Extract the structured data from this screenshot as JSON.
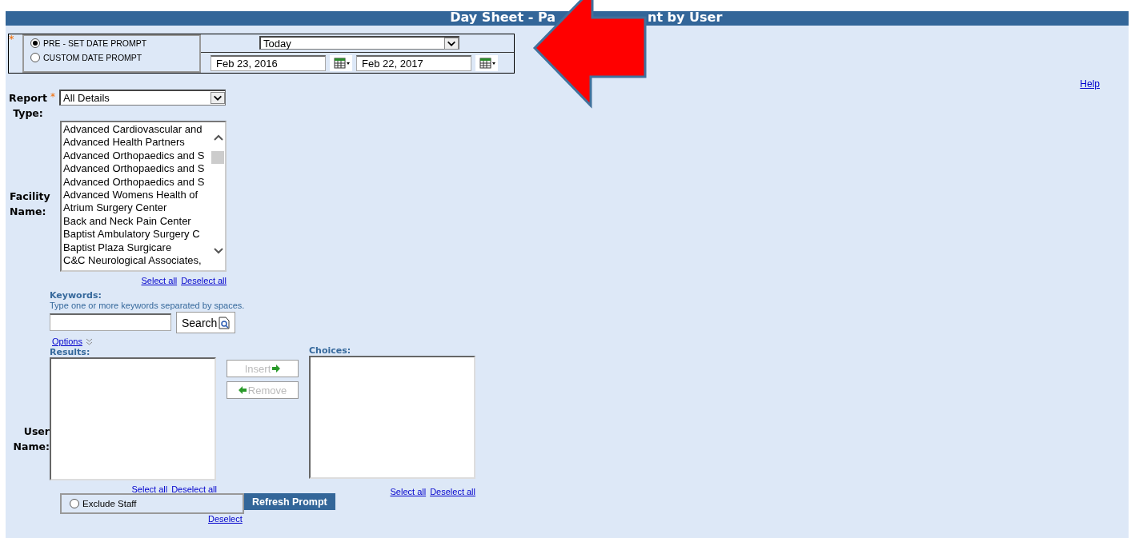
{
  "title_parts": [
    "Day Sheet - Pa",
    "nt by User"
  ],
  "date_prompt": {
    "required_mark": "*",
    "options": [
      {
        "label": "PRE - SET DATE PROMPT",
        "selected": true
      },
      {
        "label": "CUSTOM DATE PROMPT",
        "selected": false
      }
    ],
    "preset": "Today",
    "start_date": "Feb 23, 2016",
    "end_date": "Feb 22, 2017"
  },
  "help_link": "Help",
  "report_type": {
    "label": "Report Type:",
    "required_mark": "*",
    "value": "All Details"
  },
  "facility": {
    "label": "Facility Name:",
    "items": [
      "Advanced Cardiovascular and",
      "Advanced Health Partners",
      "Advanced Orthopaedics and S",
      "Advanced Orthopaedics and S",
      "Advanced Orthopaedics and S",
      "Advanced Womens Health of",
      "Atrium Surgery Center",
      "Back and Neck Pain Center",
      "Baptist Ambulatory Surgery C",
      "Baptist Plaza Surgicare",
      "C&C Neurological Associates,"
    ],
    "select_all": "Select all",
    "deselect_all": "Deselect all"
  },
  "keywords": {
    "label": "Keywords:",
    "hint": "Type one or more keywords separated by spaces.",
    "search_button": "Search",
    "options_link": "Options"
  },
  "user": {
    "label": "User Name:",
    "results_label": "Results:",
    "choices_label": "Choices:",
    "insert_button": {
      "label": "Insert",
      "disabled": true
    },
    "remove_button": {
      "label": "Remove",
      "disabled": true
    },
    "results_select_all": "Select all",
    "results_deselect_all": "Deselect all",
    "choices_select_all": "Select all",
    "choices_deselect_all": "Deselect all"
  },
  "exclude_staff": {
    "label": "Exclude Staff",
    "selected": false
  },
  "refresh_button": "Refresh Prompt",
  "deselect_link": "Deselect"
}
